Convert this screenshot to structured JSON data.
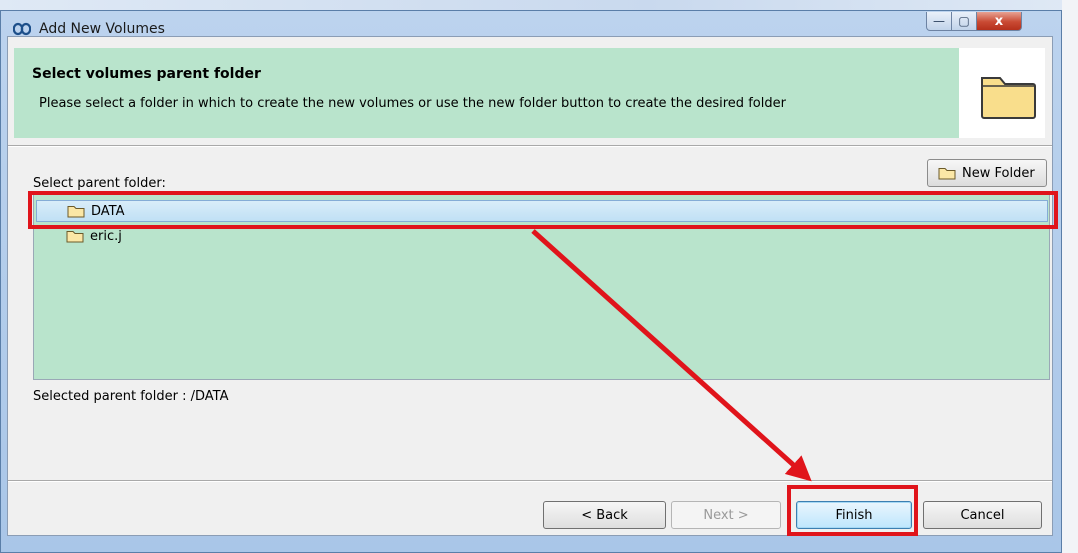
{
  "window": {
    "title": "Add New Volumes",
    "controls": {
      "minimize": "—",
      "maximize": "▢",
      "close": "x"
    }
  },
  "header": {
    "title": "Select volumes parent folder",
    "description": "Please select a folder in which to create the new volumes or use the new folder button to create the desired folder",
    "icon": "folder-icon"
  },
  "folder_picker": {
    "label": "Select parent folder:",
    "new_folder_label": "New Folder",
    "folders": [
      {
        "name": "DATA",
        "selected": true
      },
      {
        "name": "eric.j",
        "selected": false
      }
    ],
    "selected_status": "Selected parent folder : /DATA"
  },
  "buttons": {
    "back": "< Back",
    "next": "Next >",
    "finish": "Finish",
    "cancel": "Cancel"
  },
  "colors": {
    "panel_green": "#b9e4cc",
    "annotation_red": "#e0141b",
    "selection_blue": "#c0e0f5"
  }
}
